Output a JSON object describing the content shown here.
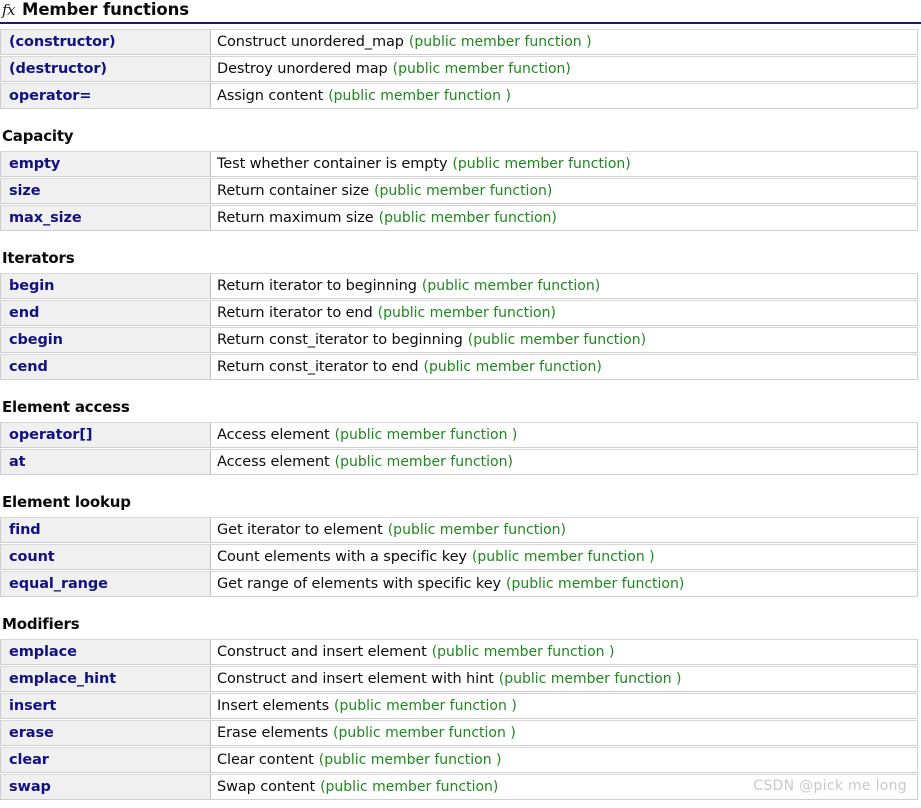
{
  "header": {
    "icon": "function-fx-icon",
    "title": "Member functions"
  },
  "colors": {
    "member_name": "#111184",
    "kind_text": "#1d881d",
    "title_rule": "#1b1b6e",
    "name_cell_bg": "#f0f0f0",
    "row_border": "#cfcfcf",
    "watermark": "#c8c8c8"
  },
  "sections": [
    {
      "heading": "",
      "rows": [
        {
          "name": "(constructor)",
          "desc": "Construct unordered_map",
          "kind": "(public member function )"
        },
        {
          "name": "(destructor)",
          "desc": "Destroy unordered map",
          "kind": "(public member function)"
        },
        {
          "name": "operator=",
          "desc": "Assign content",
          "kind": "(public member function )"
        }
      ]
    },
    {
      "heading": "Capacity",
      "rows": [
        {
          "name": "empty",
          "desc": "Test whether container is empty",
          "kind": "(public member function)"
        },
        {
          "name": "size",
          "desc": "Return container size",
          "kind": "(public member function)"
        },
        {
          "name": "max_size",
          "desc": "Return maximum size",
          "kind": "(public member function)"
        }
      ]
    },
    {
      "heading": "Iterators",
      "rows": [
        {
          "name": "begin",
          "desc": "Return iterator to beginning",
          "kind": "(public member function)"
        },
        {
          "name": "end",
          "desc": "Return iterator to end",
          "kind": "(public member function)"
        },
        {
          "name": "cbegin",
          "desc": "Return const_iterator to beginning",
          "kind": "(public member function)"
        },
        {
          "name": "cend",
          "desc": "Return const_iterator to end",
          "kind": "(public member function)"
        }
      ]
    },
    {
      "heading": "Element access",
      "rows": [
        {
          "name": "operator[]",
          "desc": "Access element",
          "kind": "(public member function )"
        },
        {
          "name": "at",
          "desc": "Access element",
          "kind": "(public member function)"
        }
      ]
    },
    {
      "heading": "Element lookup",
      "rows": [
        {
          "name": "find",
          "desc": "Get iterator to element",
          "kind": "(public member function)"
        },
        {
          "name": "count",
          "desc": "Count elements with a specific key",
          "kind": "(public member function )"
        },
        {
          "name": "equal_range",
          "desc": "Get range of elements with specific key",
          "kind": "(public member function)"
        }
      ]
    },
    {
      "heading": "Modifiers",
      "rows": [
        {
          "name": "emplace",
          "desc": "Construct and insert element",
          "kind": "(public member function )"
        },
        {
          "name": "emplace_hint",
          "desc": "Construct and insert element with hint",
          "kind": "(public member function )"
        },
        {
          "name": "insert",
          "desc": "Insert elements",
          "kind": "(public member function )"
        },
        {
          "name": "erase",
          "desc": "Erase elements",
          "kind": "(public member function )"
        },
        {
          "name": "clear",
          "desc": "Clear content",
          "kind": "(public member function )"
        },
        {
          "name": "swap",
          "desc": "Swap content",
          "kind": "(public member function)"
        }
      ]
    }
  ],
  "watermark": "CSDN @pick me long"
}
